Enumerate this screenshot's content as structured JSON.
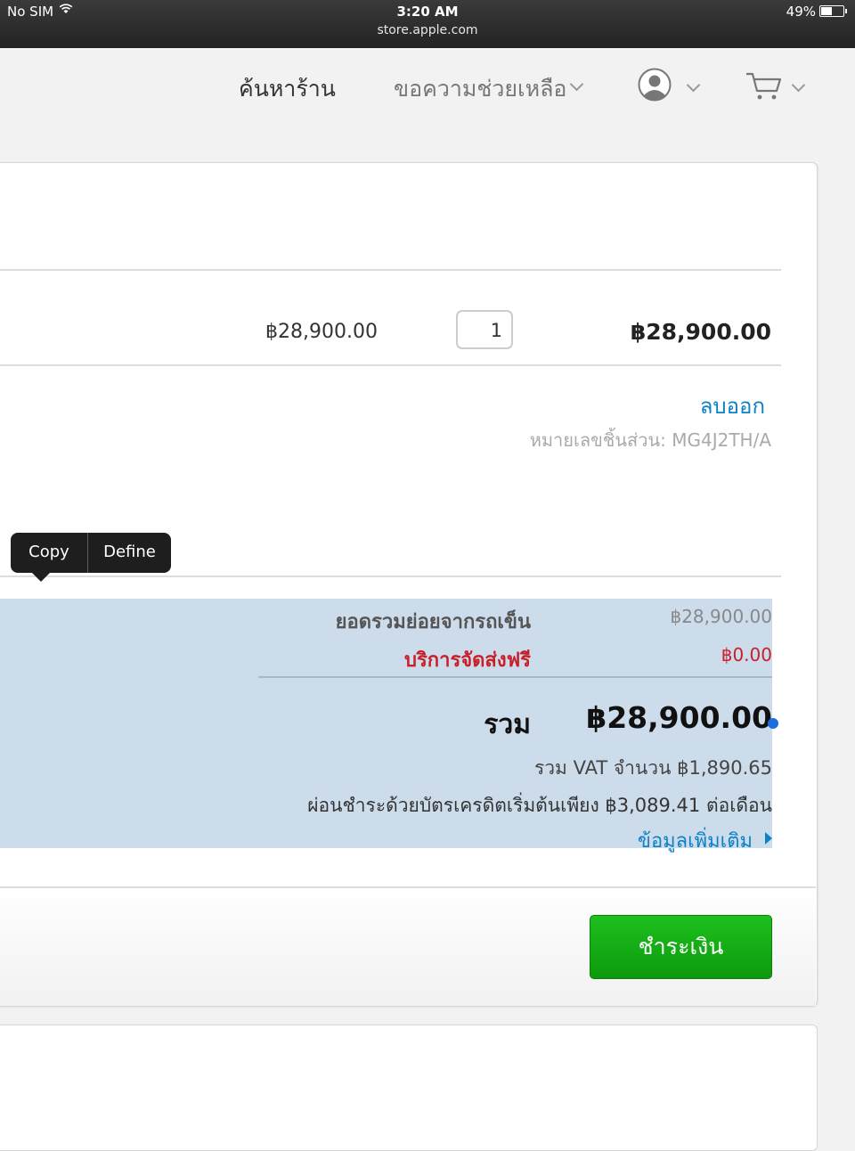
{
  "status_bar": {
    "carrier": "No SIM",
    "time": "3:20 AM",
    "url": "store.apple.com",
    "battery_percent": "49%",
    "battery_level": 0.49
  },
  "nav": {
    "find_store": "ค้นหาร้าน",
    "help": "ขอความช่วยเหลือ",
    "account_icon": "user-circle-icon",
    "cart_icon": "cart-icon"
  },
  "cart_item": {
    "unit_price": "฿28,900.00",
    "quantity": "1",
    "line_total": "฿28,900.00",
    "remove_label": "ลบออก",
    "part_number": "หมายเลขชิ้นส่วน: MG4J2TH/A"
  },
  "callout_menu": {
    "copy": "Copy",
    "define": "Define"
  },
  "summary": {
    "subtotal_label": "ยอดรวมย่อยจากรถเข็น",
    "subtotal_value": "฿28,900.00",
    "shipping_label": "บริการจัดส่งฟรี",
    "shipping_value": "฿0.00",
    "total_label": "รวม",
    "total_value": "฿28,900.00",
    "vat_text": "รวม VAT จำนวน  ฿1,890.65",
    "installment_text": "ผ่อนชำระด้วยบัตรเครดิตเริ่มต้นเพียง ฿3,089.41 ต่อเดือน",
    "more_info_link": "ข้อมูลเพิ่มเติม"
  },
  "checkout_button": "ชำระเงิน",
  "colors": {
    "link": "#0a82c8",
    "free_shipping": "#c8202a",
    "checkout_green": "#14ad14",
    "selection": "#cddceb"
  }
}
